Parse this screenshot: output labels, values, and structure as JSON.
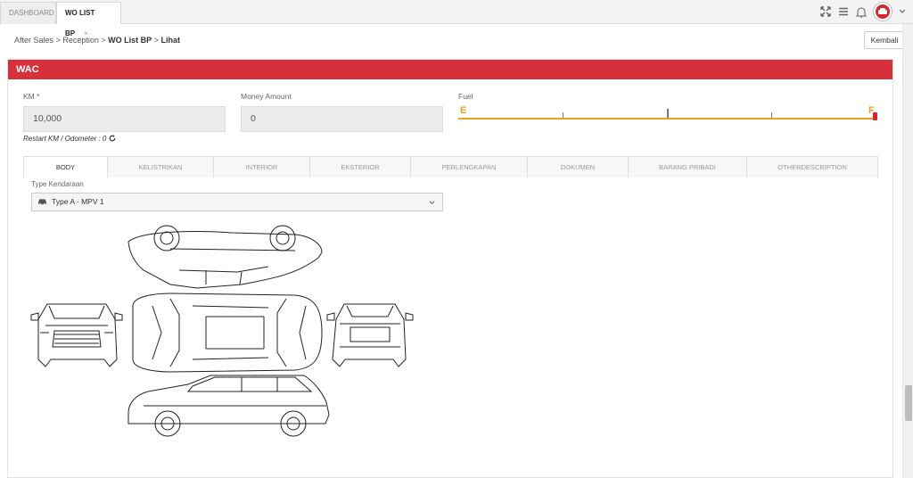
{
  "tabs": [
    {
      "label": "DASHBOARD"
    },
    {
      "label": "WO LIST BP",
      "close": "×"
    }
  ],
  "header_icons": [
    "expand-icon",
    "menu-icon",
    "bell-icon",
    "user-avatar",
    "chevron-down-icon"
  ],
  "breadcrumb": {
    "items": [
      "After Sales",
      "Reception",
      "WO List BP",
      "Lihat"
    ],
    "sep": ">"
  },
  "back_button": "Kembali",
  "panel": {
    "title": "WAC",
    "accent_color": "#d8303a"
  },
  "km": {
    "label": "KM *",
    "value": "10,000"
  },
  "money": {
    "label": "Money Amount",
    "value": "0"
  },
  "fuel": {
    "label": "Fuel",
    "empty": "E",
    "full": "F",
    "level": 1.0,
    "color": "#f0a020"
  },
  "restart_text": "Restart KM / Odometer : 0",
  "section_tabs": [
    {
      "label": "BODY",
      "active": true
    },
    {
      "label": "KELISTRIKAN"
    },
    {
      "label": "INTERIOR"
    },
    {
      "label": "EKSTERIOR"
    },
    {
      "label": "PERLENGKAPAN"
    },
    {
      "label": "DOKUMEN"
    },
    {
      "label": "BARANG PRIBADI"
    },
    {
      "label": "OTHERDESCRIPTION"
    }
  ],
  "vehicle_type": {
    "label": "Type Kendaraan",
    "value": "Type A - MPV 1",
    "icon": "car-icon"
  }
}
